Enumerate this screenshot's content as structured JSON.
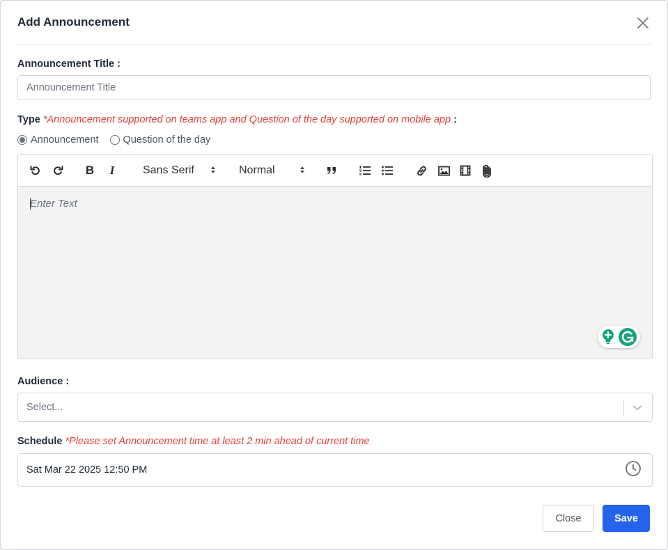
{
  "dialog": {
    "title": "Add Announcement"
  },
  "title_field": {
    "label": "Announcement Title :",
    "placeholder": "Announcement Title",
    "value": ""
  },
  "type_field": {
    "label": "Type",
    "note": "*Announcement supported on teams app and Question of the day supported on mobile app",
    "suffix": " :",
    "options": [
      {
        "label": "Announcement",
        "checked": true
      },
      {
        "label": "Question of the day",
        "checked": false
      }
    ]
  },
  "editor": {
    "font_picker": "Sans Serif",
    "size_picker": "Normal",
    "placeholder": "Enter Text",
    "toolbar_icons": [
      "undo-icon",
      "redo-icon",
      "bold-icon",
      "italic-icon",
      "blockquote-icon",
      "ordered-list-icon",
      "bullet-list-icon",
      "link-icon",
      "image-icon",
      "video-icon",
      "attachment-icon"
    ],
    "bold_glyph": "B",
    "italic_glyph": "I"
  },
  "audience_field": {
    "label": "Audience :",
    "placeholder": "Select..."
  },
  "schedule_field": {
    "label": "Schedule",
    "note": "*Please set Announcement time at least 2 min ahead of current time",
    "value": "Sat Mar 22 2025 12:50 PM"
  },
  "buttons": {
    "close": "Close",
    "save": "Save"
  },
  "colors": {
    "primary": "#2563eb",
    "note_red": "#e0403a",
    "grammarly_green": "#15a37f"
  }
}
